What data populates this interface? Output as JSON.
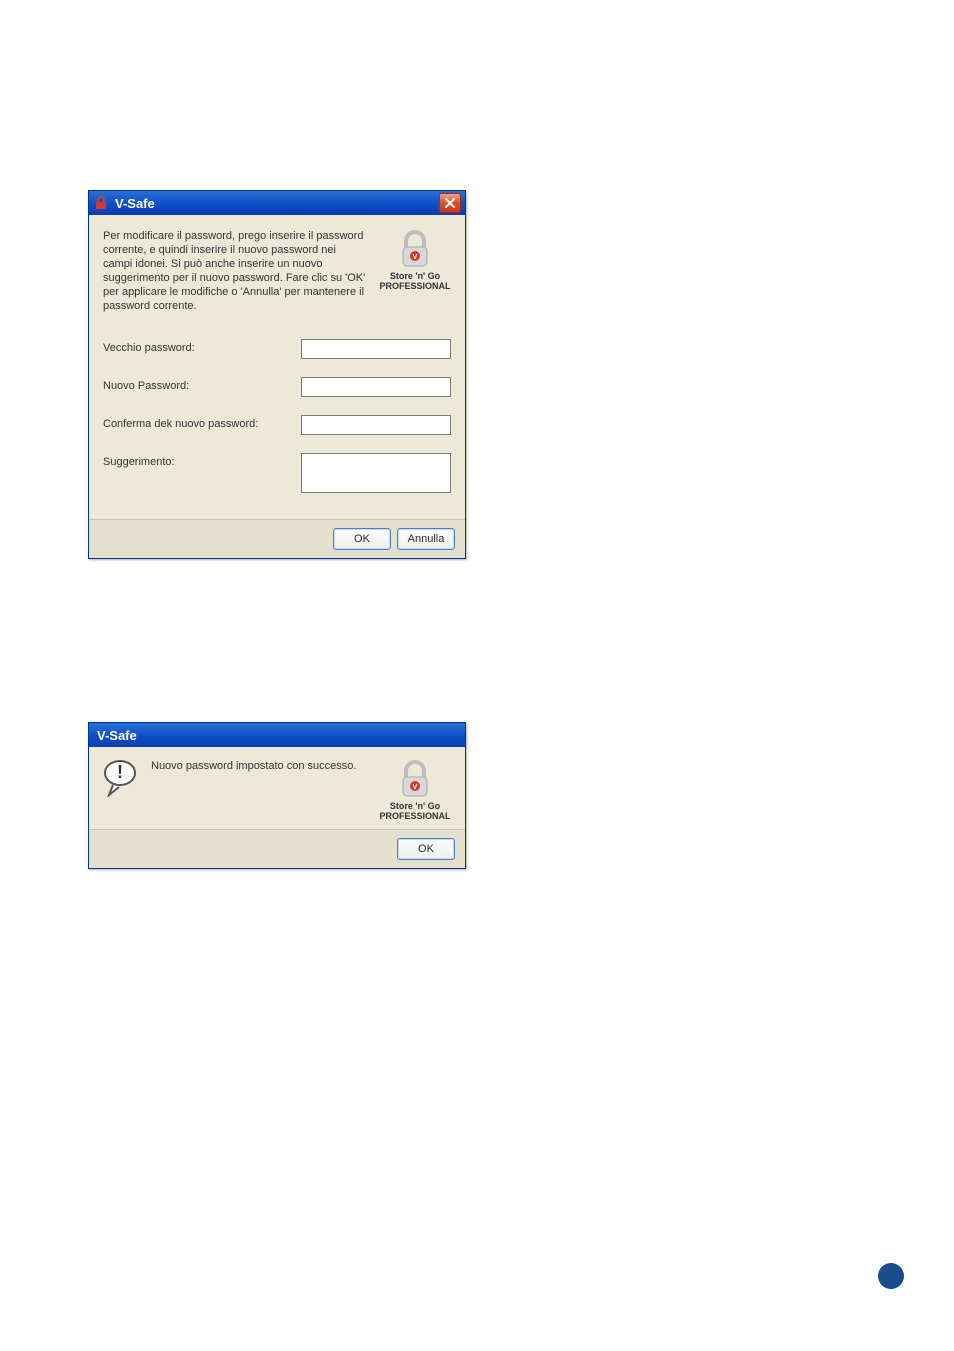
{
  "dialog1": {
    "title": "V-Safe",
    "closeGlyph": "×",
    "instructions": "Per modificare il password, prego inserire il password corrente, e quindi inserire il nuovo password nei campi idonei.  Si può anche inserire un nuovo suggerimento per il nuovo password.  Fare clic su 'OK' per applicare le modifiche o 'Annulla' per mantenere il password corrente.",
    "logoLine1": "Store 'n' Go",
    "logoLine2": "PROFESSIONAL",
    "fields": {
      "old_label": "Vecchio password:",
      "new_label": "Nuovo Password:",
      "confirm_label": "Conferma dek nuovo password:",
      "hint_label": "Suggerimento:",
      "old_value": "",
      "new_value": "",
      "confirm_value": "",
      "hint_value": ""
    },
    "buttons": {
      "ok": "OK",
      "cancel": "Annulla"
    }
  },
  "dialog2": {
    "title": "V-Safe",
    "message": "Nuovo password impostato con successo.",
    "logoLine1": "Store 'n' Go",
    "logoLine2": "PROFESSIONAL",
    "buttons": {
      "ok": "OK"
    }
  }
}
